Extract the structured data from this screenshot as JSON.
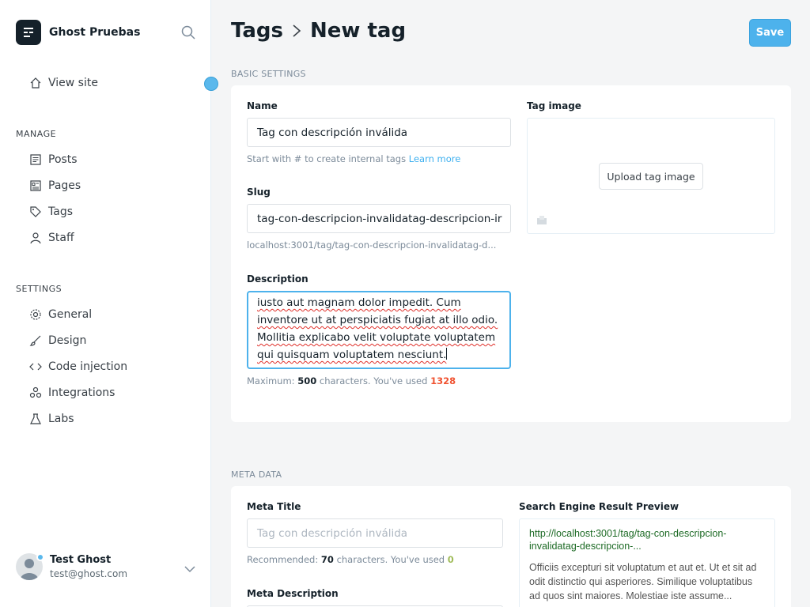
{
  "sidebar": {
    "brand_name": "Ghost Pruebas",
    "view_site": "View site",
    "manage_heading": "MANAGE",
    "manage_items": [
      {
        "label": "Posts",
        "icon": "posts-icon"
      },
      {
        "label": "Pages",
        "icon": "pages-icon"
      },
      {
        "label": "Tags",
        "icon": "tag-icon"
      },
      {
        "label": "Staff",
        "icon": "staff-icon"
      }
    ],
    "settings_heading": "SETTINGS",
    "settings_items": [
      {
        "label": "General",
        "icon": "gear-icon"
      },
      {
        "label": "Design",
        "icon": "brush-icon"
      },
      {
        "label": "Code injection",
        "icon": "code-icon"
      },
      {
        "label": "Integrations",
        "icon": "integrations-icon"
      },
      {
        "label": "Labs",
        "icon": "flask-icon"
      }
    ],
    "user": {
      "name": "Test Ghost",
      "email": "test@ghost.com"
    }
  },
  "header": {
    "crumb_parent": "Tags",
    "crumb_current": "New tag",
    "save_label": "Save"
  },
  "basic": {
    "section_label": "BASIC SETTINGS",
    "name_label": "Name",
    "name_value": "Tag con descripción inválida",
    "name_hint": "Start with # to create internal tags",
    "name_hint_link": "Learn more",
    "slug_label": "Slug",
    "slug_value": "tag-con-descripcion-invalidatag-descripcion-ir",
    "slug_url": "localhost:3001/tag/tag-con-descripcion-invalidatag-d...",
    "description_label": "Description",
    "description_lines": [
      "iusto aut magnam dolor impedit. Cum",
      "inventore ut at perspiciatis fugiat at illo odio.",
      "Mollitia explicabo velit voluptate voluptatem",
      "qui quisquam voluptatem nesciunt."
    ],
    "desc_hint_prefix": "Maximum:",
    "desc_max": "500",
    "desc_hint_mid": "characters. You've used",
    "desc_used": "1328",
    "image_label": "Tag image",
    "upload_label": "Upload tag image"
  },
  "meta": {
    "section_label": "META DATA",
    "title_label": "Meta Title",
    "title_placeholder": "Tag con descripción inválida",
    "title_hint_prefix": "Recommended:",
    "title_recommended": "70",
    "title_hint_mid": "characters. You've used",
    "title_used": "0",
    "description_label": "Meta Description",
    "serp_label": "Search Engine Result Preview",
    "serp_url": "http://localhost:3001/tag/tag-con-descripcion-invalidatag-descripcion-...",
    "serp_desc": "Officiis excepturi sit voluptatum et aut et. Ut et sit ad odit distinctio qui asperiores. Similique voluptatibus ad quos sint maiores. Molestiae iste assume..."
  },
  "colors": {
    "accent": "#4db2ec",
    "error": "#f05230",
    "success": "#9fbb58"
  }
}
